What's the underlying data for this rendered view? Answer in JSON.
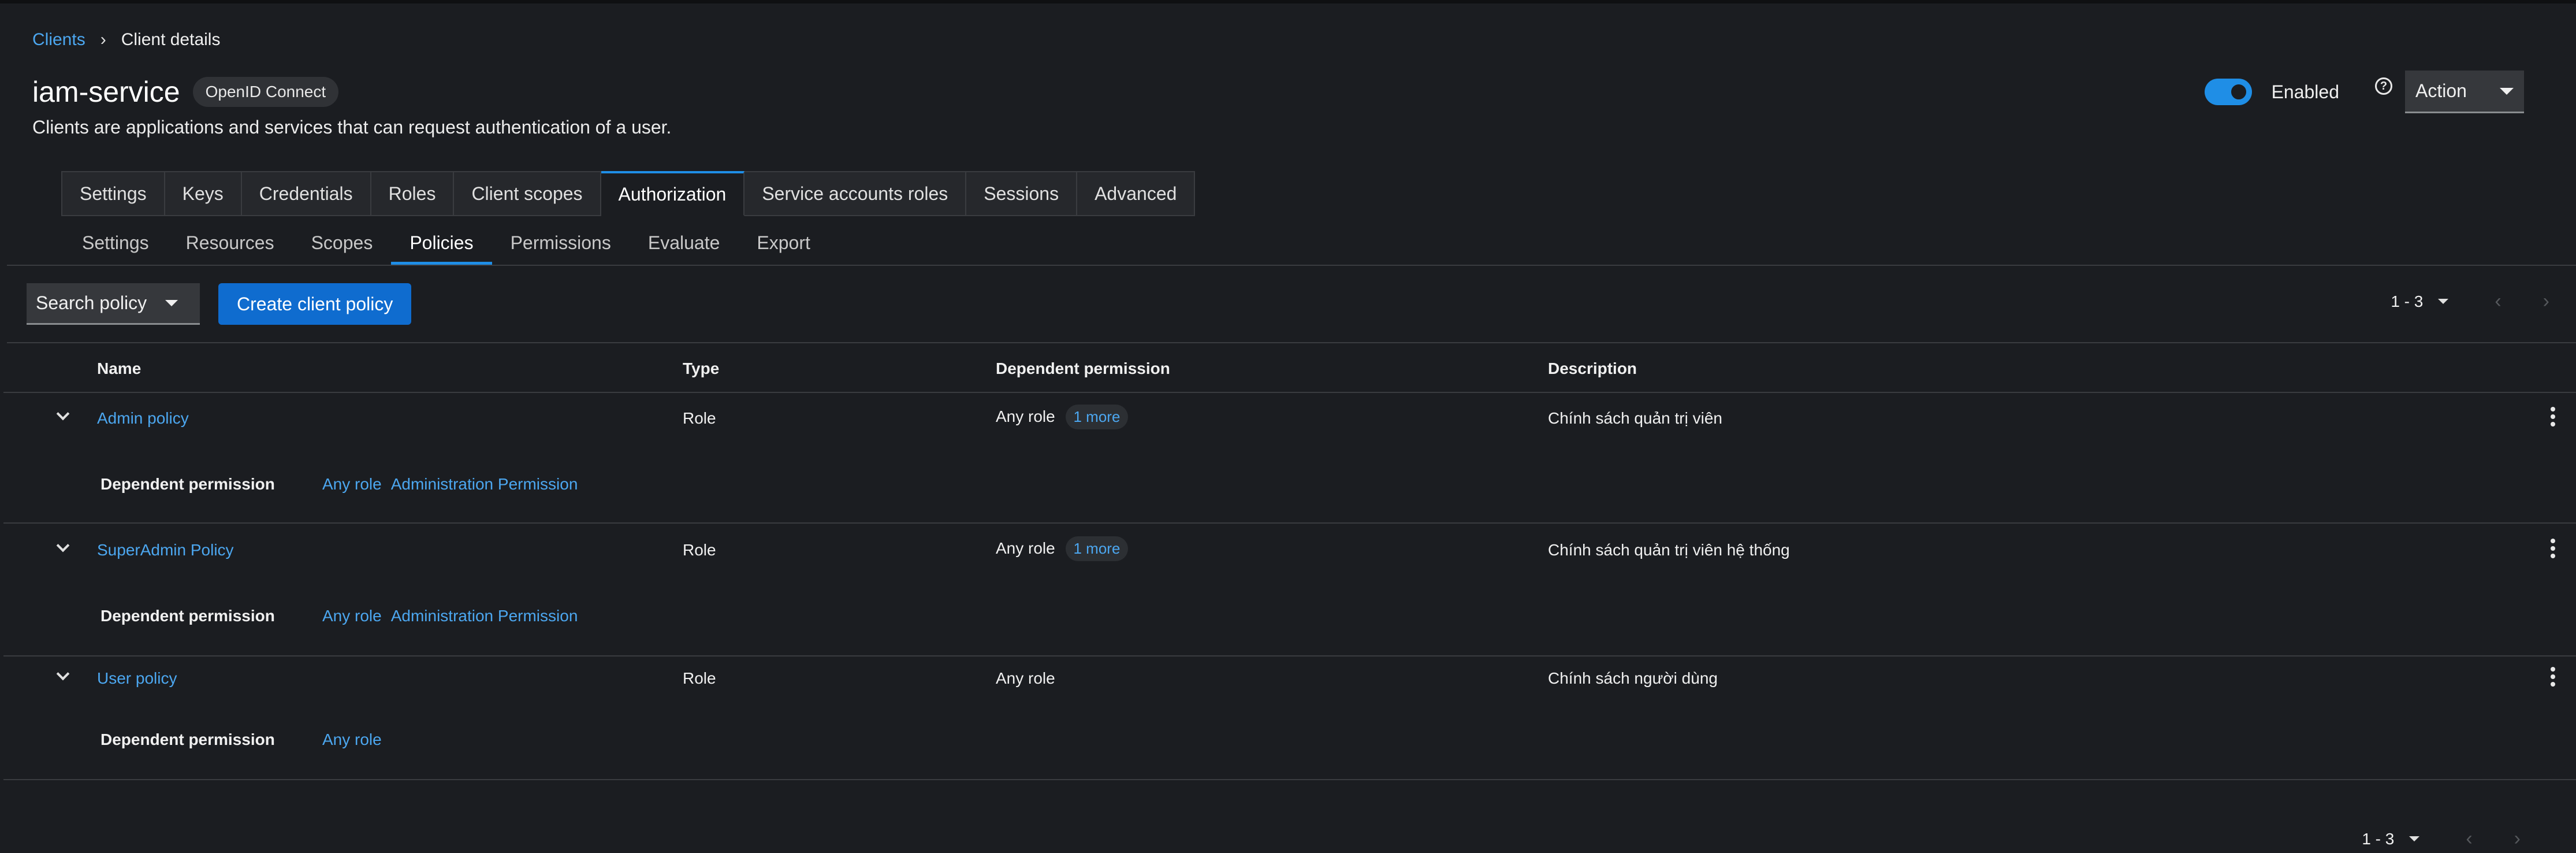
{
  "breadcrumb": {
    "parent": "Clients",
    "separator": "›",
    "current": "Client details"
  },
  "header": {
    "title": "iam-service",
    "protocol_badge": "OpenID Connect",
    "description": "Clients are applications and services that can request authentication of a user.",
    "enabled_label": "Enabled",
    "enabled": true,
    "help_symbol": "?",
    "action_label": "Action"
  },
  "tabs": [
    {
      "label": "Settings"
    },
    {
      "label": "Keys"
    },
    {
      "label": "Credentials"
    },
    {
      "label": "Roles"
    },
    {
      "label": "Client scopes"
    },
    {
      "label": "Authorization"
    },
    {
      "label": "Service accounts roles"
    },
    {
      "label": "Sessions"
    },
    {
      "label": "Advanced"
    }
  ],
  "subtabs": [
    {
      "label": "Settings"
    },
    {
      "label": "Resources"
    },
    {
      "label": "Scopes"
    },
    {
      "label": "Policies"
    },
    {
      "label": "Permissions"
    },
    {
      "label": "Evaluate"
    },
    {
      "label": "Export"
    }
  ],
  "toolbar": {
    "search_label": "Search policy",
    "create_label": "Create client policy"
  },
  "pagination": {
    "range": "1 - 3",
    "prev": "‹",
    "next": "›"
  },
  "table": {
    "columns": {
      "name": "Name",
      "type": "Type",
      "dependent": "Dependent permission",
      "description": "Description"
    },
    "detail_label": "Dependent permission",
    "rows": [
      {
        "name": "Admin policy",
        "type": "Role",
        "dependent": "Any role",
        "more": "1 more",
        "description": "Chính sách quản trị viên",
        "detail_links": [
          "Any role",
          "Administration Permission"
        ]
      },
      {
        "name": "SuperAdmin Policy",
        "type": "Role",
        "dependent": "Any role",
        "more": "1 more",
        "description": "Chính sách quản trị viên hệ thống",
        "detail_links": [
          "Any role",
          "Administration Permission"
        ]
      },
      {
        "name": "User policy",
        "type": "Role",
        "dependent": "Any role",
        "description": "Chính sách người dùng",
        "detail_links": [
          "Any role"
        ]
      }
    ]
  },
  "colors": {
    "accent": "#1f8ee6",
    "link": "#4ca7f0",
    "background": "#1b1d21",
    "primary_button": "#0f6ccf"
  }
}
